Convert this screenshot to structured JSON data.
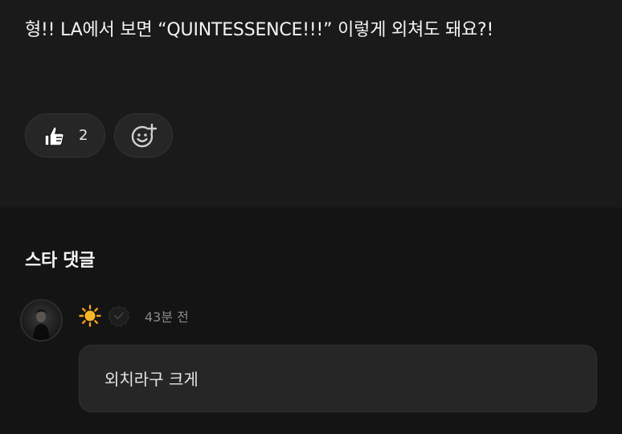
{
  "post": {
    "text": "형!! LA에서 보면 “QUINTESSENCE!!!” 이렇게 외쳐도 돼요?!",
    "reactions": {
      "like_icon": "thumbs-up-icon",
      "like_count": "2",
      "add_icon": "add-reaction-smiley-icon"
    }
  },
  "comments": {
    "title": "스타 댓글",
    "items": [
      {
        "avatar": "avatar",
        "emoji_icon": "sun-icon",
        "badge_icon": "verified-badge-icon",
        "time": "43분 전",
        "text": "외치라구 크게"
      }
    ]
  },
  "colors": {
    "post_background": "#1a1a1a",
    "comments_background": "#141414",
    "bubble_background": "#262626",
    "sun": "#f7a21b"
  }
}
